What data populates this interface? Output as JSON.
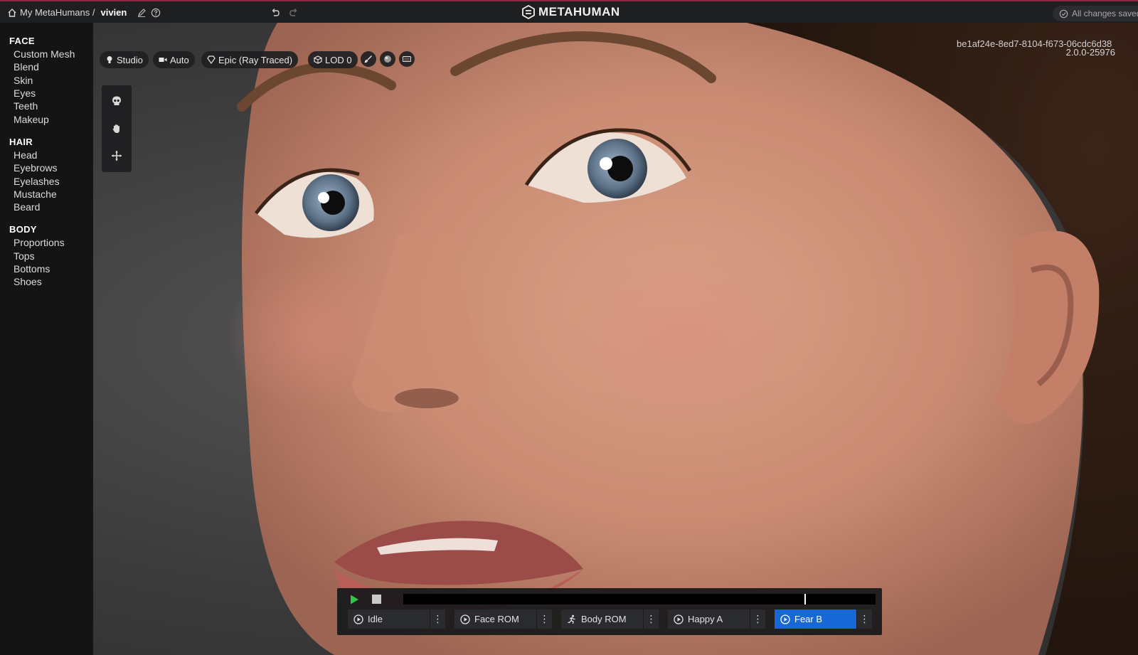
{
  "topbar": {
    "breadcrumb_root": "My MetaHumans /",
    "character_name": "vivien",
    "logo_text": "METAHUMAN",
    "save_status": "All changes saved"
  },
  "sidebar": {
    "sections": [
      {
        "title": "FACE",
        "items": [
          "Custom Mesh",
          "Blend",
          "Skin",
          "Eyes",
          "Teeth",
          "Makeup"
        ]
      },
      {
        "title": "HAIR",
        "items": [
          "Head",
          "Eyebrows",
          "Eyelashes",
          "Mustache",
          "Beard"
        ]
      },
      {
        "title": "BODY",
        "items": [
          "Proportions",
          "Tops",
          "Bottoms",
          "Shoes"
        ]
      }
    ]
  },
  "viewport_toolbar": {
    "lighting": "Studio",
    "camera": "Auto",
    "quality": "Epic (Ray Traced)",
    "lod": "LOD 0"
  },
  "version": "2.0.0-25976",
  "guid": "be1af24e-8ed7-8104-f673-06cdc6d38",
  "player": {
    "progress": 0.85,
    "animations": [
      {
        "label": "Idle",
        "icon": "play-circle-icon",
        "active": false
      },
      {
        "label": "Face ROM",
        "icon": "play-circle-icon",
        "active": false
      },
      {
        "label": "Body ROM",
        "icon": "running-figure-icon",
        "active": false
      },
      {
        "label": "Happy A",
        "icon": "play-circle-icon",
        "active": false
      },
      {
        "label": "Fear B",
        "icon": "play-circle-icon",
        "active": true
      }
    ],
    "more_glyph": "⋮"
  },
  "colors": {
    "accent": "#1767d6",
    "play_green": "#2ec84a",
    "topbar_border": "#8f2a45"
  }
}
